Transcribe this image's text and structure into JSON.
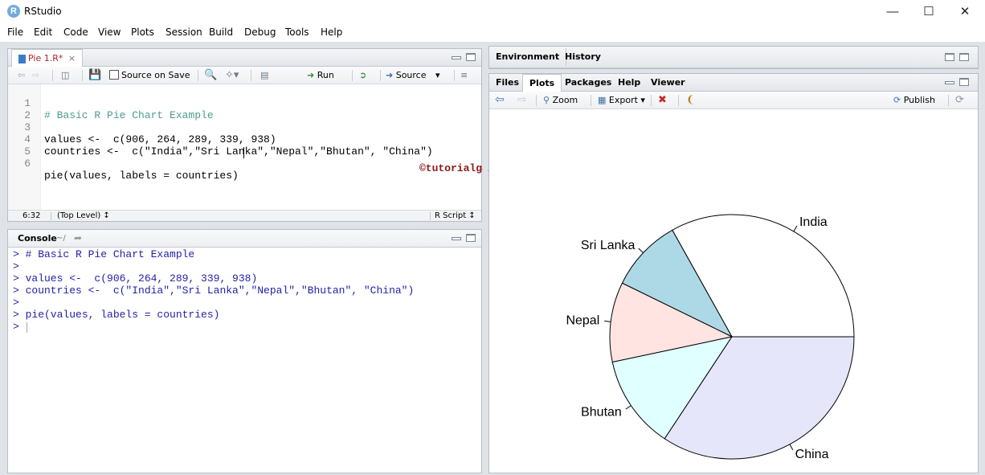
{
  "window": {
    "title": "RStudio",
    "icon_letter": "R"
  },
  "menu": [
    "File",
    "Edit",
    "Code",
    "View",
    "Plots",
    "Session",
    "Build",
    "Debug",
    "Tools",
    "Help"
  ],
  "editor": {
    "tab_label": "Pie 1.R*",
    "source_on_save": "Source on Save",
    "run_label": "Run",
    "source_label": "Source",
    "line_numbers": [
      "1",
      "2",
      "3",
      "4",
      "5",
      "6"
    ],
    "lines": [
      "# Basic R Pie Chart Example",
      "",
      "values <-  c(906, 264, 289, 339, 938)",
      "countries <-  c(\"India\",\"Sri Lanka\",\"Nepal\",\"Bhutan\", \"China\")",
      "",
      "pie(values, labels = countries)"
    ],
    "status_position": "6:32",
    "status_scope": "(Top Level) ↕",
    "status_filetype": "R Script ↕"
  },
  "console": {
    "title": "Console",
    "path": "~/",
    "lines": [
      "> # Basic R Pie Chart Example",
      ">",
      "> values <-  c(906, 264, 289, 339, 938)",
      "> countries <-  c(\"India\",\"Sri Lanka\",\"Nepal\",\"Bhutan\", \"China\")",
      ">",
      "> pie(values, labels = countries)",
      "> "
    ]
  },
  "env_pane": {
    "tabs": [
      "Environment",
      "History"
    ]
  },
  "files_pane": {
    "tabs": [
      "Files",
      "Plots",
      "Packages",
      "Help",
      "Viewer"
    ],
    "active_tab": "Plots",
    "zoom_label": "Zoom",
    "export_label": "Export ▾",
    "publish_label": "Publish"
  },
  "watermark": "©tutorialgateway.org",
  "chart_data": {
    "type": "pie",
    "categories": [
      "India",
      "Sri Lanka",
      "Nepal",
      "Bhutan",
      "China"
    ],
    "values": [
      906,
      264,
      289,
      339,
      938
    ],
    "colors": [
      "#ffffff",
      "#add8e6",
      "#ffe4e1",
      "#e0ffff",
      "#e6e6fa"
    ],
    "title": ""
  }
}
